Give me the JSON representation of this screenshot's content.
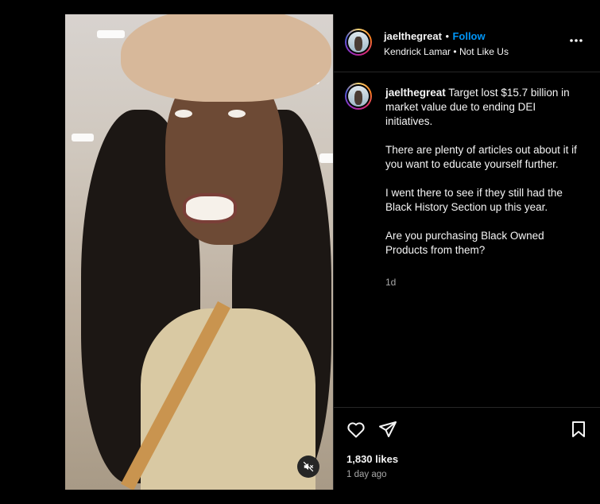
{
  "header": {
    "username": "jaelthegreat",
    "separator": "•",
    "follow_label": "Follow",
    "audio_artist": "Kendrick Lamar",
    "audio_separator": "•",
    "audio_track": "Not Like Us",
    "more_label": "•••"
  },
  "caption": {
    "username": "jaelthegreat",
    "text": " Target lost $15.7 billion in market value due to ending DEI initiatives.\n\nThere are plenty of articles out about it if you want to educate yourself further.\n\nI went there to see if they still had the Black History Section up this year.\n\nAre you purchasing Black Owned Products from them?",
    "age": "1d"
  },
  "actions": {
    "likes": "1,830 likes",
    "date": "1 day ago"
  },
  "icons": {
    "like": "heart-icon",
    "share": "send-icon",
    "save": "bookmark-icon",
    "mute": "speaker-muted-icon",
    "more": "more-horizontal-icon"
  },
  "colors": {
    "background": "#000000",
    "link": "#0095f6",
    "muted_text": "#a8a8a8",
    "divider": "#262626"
  }
}
